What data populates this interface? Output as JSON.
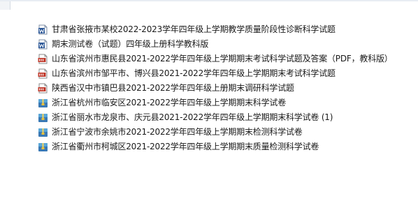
{
  "files": [
    {
      "icon": "word-icon",
      "name": "甘肃省张掖市某校2022-2023学年四年级上学期教学质量阶段性诊断科学试题"
    },
    {
      "icon": "word-icon",
      "name": "期末测试卷（试题）四年级上册科学教科版"
    },
    {
      "icon": "pdf-icon",
      "name": "山东省滨州市惠民县2021-2022学年四年级上学期期末考试科学试题及答案（PDF，教科版）"
    },
    {
      "icon": "pdf-icon",
      "name": "山东省滨州市邹平市、博兴县2021-2022学年四年级上学期期末考试科学试题"
    },
    {
      "icon": "pdf-icon",
      "name": "陕西省汉中市镇巴县2021-2022学年四年级上册期末调研科学试题"
    },
    {
      "icon": "archive-icon",
      "name": "浙江省杭州市临安区2021-2022学年四年级上学期期末科学试卷"
    },
    {
      "icon": "archive-icon",
      "name": "浙江省丽水市龙泉市、庆元县2021-2022学年四年级上学期期末科学试卷 (1)"
    },
    {
      "icon": "archive-icon",
      "name": "浙江省宁波市余姚市2021-2022学年四年级上学期期末检测科学试卷"
    },
    {
      "icon": "archive-icon",
      "name": "浙江省衢州市柯城区2021-2022学年四年级上学期期末质量检测科学试卷"
    }
  ],
  "colors": {
    "word": "#2b5797",
    "pdf": "#c0392b",
    "archive_top": "#5aa7d8",
    "archive_bottom": "#3a79b5"
  }
}
